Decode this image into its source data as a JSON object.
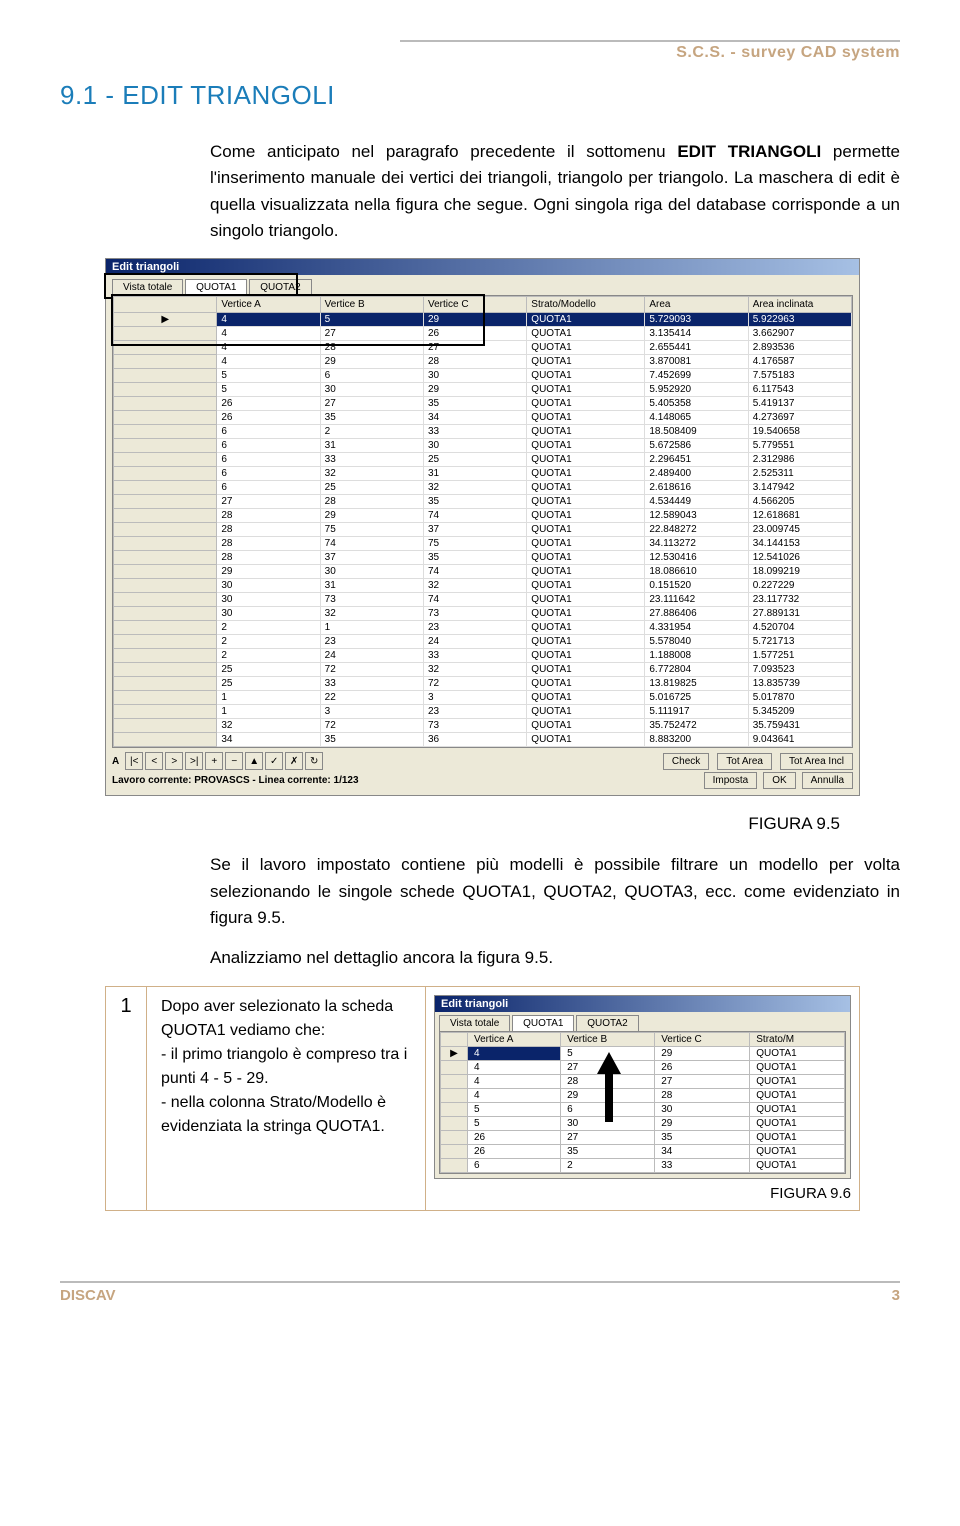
{
  "header": {
    "brand": "S.C.S. - survey CAD system"
  },
  "h1": "9.1 - EDIT TRIANGOLI",
  "para1_a": "Come anticipato nel paragrafo precedente il sottomenu ",
  "para1_b": "EDIT TRIANGOLI",
  "para1_c": " permette l'inserimento manuale dei vertici dei triangoli, triangolo per triangolo. La maschera di edit è quella visualizzata nella figura che segue. Ogni singola riga del database corrisponde a un singolo triangolo.",
  "fig95_caption": "FIGURA 9.5",
  "para2": "Se il lavoro impostato contiene più modelli è possibile filtrare un modello per volta selezionando le singole schede QUOTA1, QUOTA2, QUOTA3, ecc. come evidenziato in figura 9.5.",
  "para3": "Analizziamo nel dettaglio ancora la figura 9.5.",
  "step1": {
    "num": "1",
    "text": "Dopo aver selezionato la scheda QUOTA1 vediamo che:\n- il primo triangolo è compreso tra i punti 4 - 5 - 29.\n- nella colonna Strato/Modello è evidenziata la stringa QUOTA1.",
    "caption": "FIGURA 9.6"
  },
  "footer": {
    "left": "DISCAV",
    "page": "3"
  },
  "dialog": {
    "title": "Edit triangoli",
    "tabs": [
      "Vista totale",
      "QUOTA1",
      "QUOTA2"
    ],
    "columns": [
      "Vertice A",
      "Vertice B",
      "Vertice C",
      "Strato/Modello",
      "Area",
      "Area inclinata"
    ],
    "nav_label": "A",
    "btn_check": "Check",
    "btn_totarea": "Tot Area",
    "btn_totareaincl": "Tot Area Incl",
    "status": "Lavoro corrente: PROVASCS - Linea corrente: 1/123",
    "btn_imposta": "Imposta",
    "btn_ok": "OK",
    "btn_annulla": "Annulla",
    "rows": [
      [
        "4",
        "5",
        "29",
        "QUOTA1",
        "5.729093",
        "5.922963"
      ],
      [
        "4",
        "27",
        "26",
        "QUOTA1",
        "3.135414",
        "3.662907"
      ],
      [
        "4",
        "28",
        "27",
        "QUOTA1",
        "2.655441",
        "2.893536"
      ],
      [
        "4",
        "29",
        "28",
        "QUOTA1",
        "3.870081",
        "4.176587"
      ],
      [
        "5",
        "6",
        "30",
        "QUOTA1",
        "7.452699",
        "7.575183"
      ],
      [
        "5",
        "30",
        "29",
        "QUOTA1",
        "5.952920",
        "6.117543"
      ],
      [
        "26",
        "27",
        "35",
        "QUOTA1",
        "5.405358",
        "5.419137"
      ],
      [
        "26",
        "35",
        "34",
        "QUOTA1",
        "4.148065",
        "4.273697"
      ],
      [
        "6",
        "2",
        "33",
        "QUOTA1",
        "18.508409",
        "19.540658"
      ],
      [
        "6",
        "31",
        "30",
        "QUOTA1",
        "5.672586",
        "5.779551"
      ],
      [
        "6",
        "33",
        "25",
        "QUOTA1",
        "2.296451",
        "2.312986"
      ],
      [
        "6",
        "32",
        "31",
        "QUOTA1",
        "2.489400",
        "2.525311"
      ],
      [
        "6",
        "25",
        "32",
        "QUOTA1",
        "2.618616",
        "3.147942"
      ],
      [
        "27",
        "28",
        "35",
        "QUOTA1",
        "4.534449",
        "4.566205"
      ],
      [
        "28",
        "29",
        "74",
        "QUOTA1",
        "12.589043",
        "12.618681"
      ],
      [
        "28",
        "75",
        "37",
        "QUOTA1",
        "22.848272",
        "23.009745"
      ],
      [
        "28",
        "74",
        "75",
        "QUOTA1",
        "34.113272",
        "34.144153"
      ],
      [
        "28",
        "37",
        "35",
        "QUOTA1",
        "12.530416",
        "12.541026"
      ],
      [
        "29",
        "30",
        "74",
        "QUOTA1",
        "18.086610",
        "18.099219"
      ],
      [
        "30",
        "31",
        "32",
        "QUOTA1",
        "0.151520",
        "0.227229"
      ],
      [
        "30",
        "73",
        "74",
        "QUOTA1",
        "23.111642",
        "23.117732"
      ],
      [
        "30",
        "32",
        "73",
        "QUOTA1",
        "27.886406",
        "27.889131"
      ],
      [
        "2",
        "1",
        "23",
        "QUOTA1",
        "4.331954",
        "4.520704"
      ],
      [
        "2",
        "23",
        "24",
        "QUOTA1",
        "5.578040",
        "5.721713"
      ],
      [
        "2",
        "24",
        "33",
        "QUOTA1",
        "1.188008",
        "1.577251"
      ],
      [
        "25",
        "72",
        "32",
        "QUOTA1",
        "6.772804",
        "7.093523"
      ],
      [
        "25",
        "33",
        "72",
        "QUOTA1",
        "13.819825",
        "13.835739"
      ],
      [
        "1",
        "22",
        "3",
        "QUOTA1",
        "5.016725",
        "5.017870"
      ],
      [
        "1",
        "3",
        "23",
        "QUOTA1",
        "5.111917",
        "5.345209"
      ],
      [
        "32",
        "72",
        "73",
        "QUOTA1",
        "35.752472",
        "35.759431"
      ],
      [
        "34",
        "35",
        "36",
        "QUOTA1",
        "8.883200",
        "9.043641"
      ]
    ]
  },
  "mini": {
    "title": "Edit triangoli",
    "tabs": [
      "Vista totale",
      "QUOTA1",
      "QUOTA2"
    ],
    "columns": [
      "Vertice A",
      "Vertice B",
      "Vertice C",
      "Strato/M"
    ],
    "rows": [
      [
        "4",
        "5",
        "29",
        "QUOTA1"
      ],
      [
        "4",
        "27",
        "26",
        "QUOTA1"
      ],
      [
        "4",
        "28",
        "27",
        "QUOTA1"
      ],
      [
        "4",
        "29",
        "28",
        "QUOTA1"
      ],
      [
        "5",
        "6",
        "30",
        "QUOTA1"
      ],
      [
        "5",
        "30",
        "29",
        "QUOTA1"
      ],
      [
        "26",
        "27",
        "35",
        "QUOTA1"
      ],
      [
        "26",
        "35",
        "34",
        "QUOTA1"
      ],
      [
        "6",
        "2",
        "33",
        "QUOTA1"
      ]
    ]
  }
}
